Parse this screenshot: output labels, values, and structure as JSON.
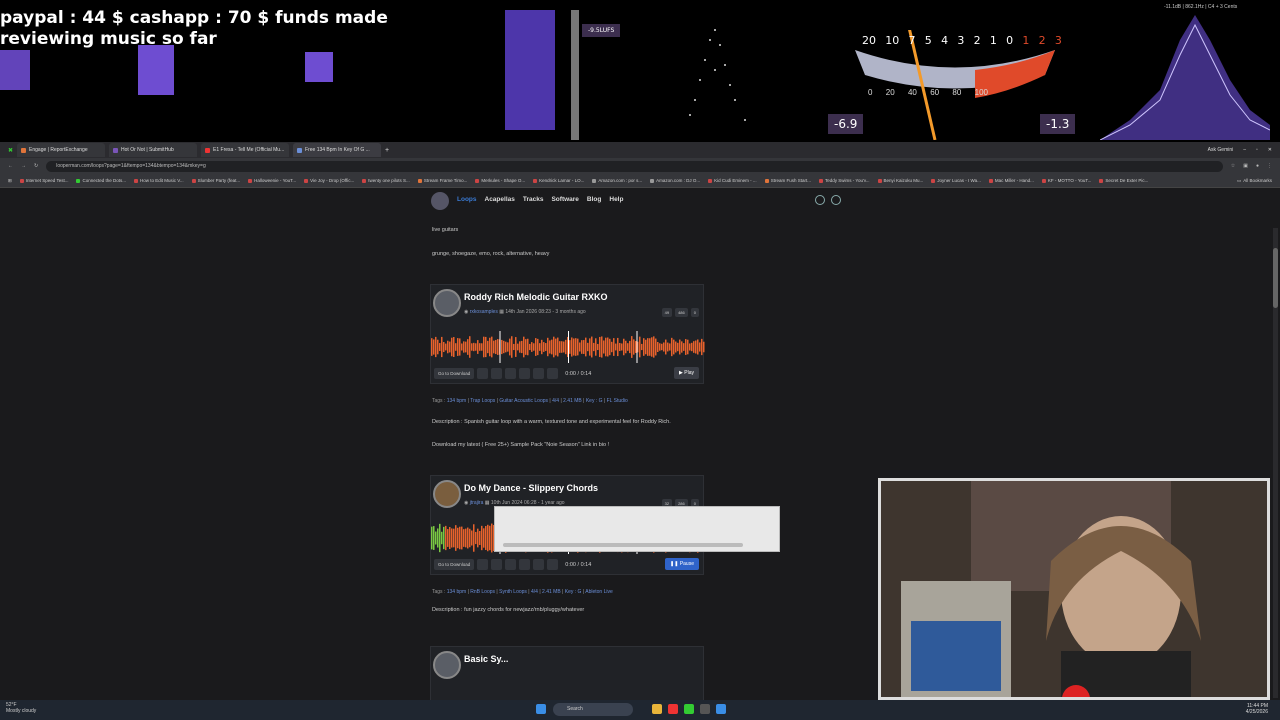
{
  "overlay": {
    "funds_line1": "paypal : 44 $  cashapp : 70 $ funds made",
    "funds_line2": "reviewing music so far",
    "meter_label": "-9.5LUFS",
    "vu_left_value": "-6.9",
    "vu_right_value": "-1.3",
    "vu_top_scale": [
      "20",
      "10",
      "7",
      "5",
      "4",
      "3",
      "2",
      "1",
      "0",
      "1",
      "2",
      "3"
    ],
    "vu_bottom_scale": [
      "0",
      "20",
      "40",
      "60",
      "80",
      "100"
    ],
    "spectrum_readout": "-11.1dB | 862.1Hz | C4 + 3 Cents"
  },
  "browser": {
    "tabs": [
      {
        "label": "Engage | ReportExchange",
        "color": "#e0743a"
      },
      {
        "label": "Hot Or Not | SubmitHub",
        "color": "#7a55b8"
      },
      {
        "label": "E1 Fresa - Tell Me (Official Mu...",
        "color": "#e33"
      },
      {
        "label": "Free 134 Bpm In Key Of G ...",
        "color": "#6b8fd8"
      }
    ],
    "ask_gemini": "Ask Gemini",
    "url": "looperman.com/loops?page=1&ftempo=134&btempo=134&mkey=g",
    "bookmarks": [
      "Internet Speed Test...",
      "Connected the Dots...",
      "How to Edit Music V...",
      "Slumber Party (feat...",
      "Halloweenie - YouT...",
      "Vie Joy - Drop (Offic...",
      "twenty one pilots S...",
      "Stream Frame Timo...",
      "Merkules - Shape O...",
      "Kendrick Lamar - LO...",
      "Amazon.com : por s...",
      "Amazon.com : DJ O...",
      "Kid Cudi Eminem - ...",
      "Stream Fush Start...",
      "Teddy Swims - You'v...",
      "Benyi Kaizoku Mu...",
      "Joyner Lucas - I Wa...",
      "Mac Miller - Hand...",
      "KF - MOTTO - YouT...",
      "Secret De Exter Pic..."
    ],
    "all_bookmarks": "All Bookmarks"
  },
  "site": {
    "nav": [
      "Loops",
      "Acapellas",
      "Tracks",
      "Software",
      "Blog",
      "Help"
    ],
    "prev_description_tail": "live guitars",
    "prev_tags": "grunge, shoegaze, emo, rock, alternative, heavy",
    "loops": [
      {
        "title": "Roddy Rich Melodic Guitar RXKO",
        "author": "rxkosamples",
        "date": "14th Jan 2026 08:23 - 3 months ago",
        "stats": [
          "49",
          "486",
          "0"
        ],
        "download_label": "Go to Download",
        "time": "0:00 / 0:14",
        "play_label": "Play",
        "tags_prefix": "Tags :",
        "tags": [
          "134 bpm",
          "Trap Loops",
          "Guitar Acoustic Loops",
          "4/4",
          "2.41 MB",
          "Key : G",
          "FL Studio"
        ],
        "description": "Description : Spanish guitar loop with a warm, textured tone and experimental feel for Roddy Rich.",
        "extra": "Download my latest ( Free 25+) Sample Pack \"Noie Season\" Link in bio !"
      },
      {
        "title": "Do My Dance - Slippery Chords",
        "author": "jtrajira",
        "date": "10th Jun 2024 06:28 - 1 year ago",
        "stats": [
          "32",
          "286",
          "0"
        ],
        "download_label": "Go to Download",
        "time": "0:00 / 0:14",
        "play_label": "Pause",
        "progress": 0.05,
        "tags_prefix": "Tags :",
        "tags": [
          "134 bpm",
          "RnB Loops",
          "Synth Loops",
          "4/4",
          "2.41 MB",
          "Key : G",
          "Ableton Live"
        ],
        "description": "Description : fun jazzy chords for newjazz/rnb/pluggy/whatever"
      },
      {
        "title": "Basic Sy..."
      }
    ]
  },
  "taskbar": {
    "weather_temp": "52°F",
    "weather_desc": "Mostly cloudy",
    "search": "Search",
    "time": "11:44 PM",
    "date": "4/25/2026"
  },
  "colors": {
    "accent": "#3a7bd5",
    "wave": "#e8622c",
    "wave_played": "#7ac943"
  }
}
